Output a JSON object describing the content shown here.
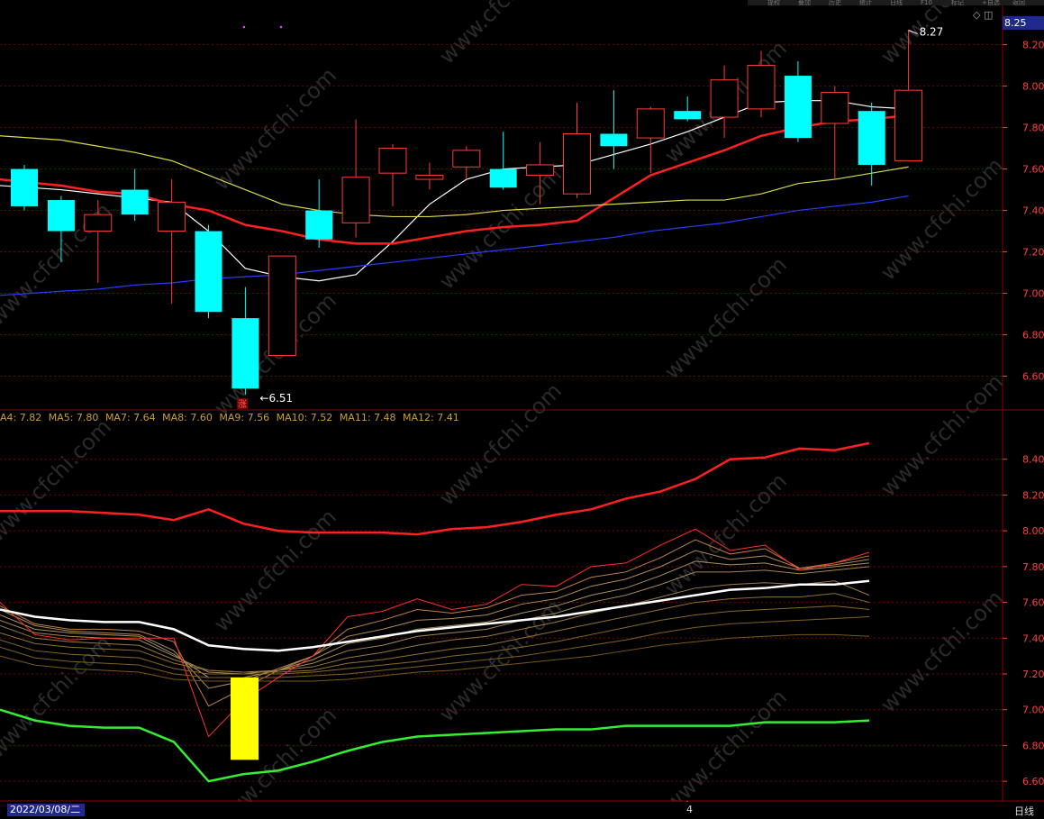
{
  "toolbar": {
    "items": [
      "提权",
      "叠加",
      "历史",
      "统计",
      "日线",
      "F10",
      "标记",
      "+自选",
      "返回"
    ]
  },
  "current_price_box": "8.25",
  "top_panel": {
    "high_label": "8.27",
    "low_label": "6.51",
    "badge": "涨"
  },
  "ma_legend": [
    "A4: 7.82",
    "MA5: 7.80",
    "MA7: 7.64",
    "MA8: 7.60",
    "MA9: 7.56",
    "MA10: 7.52",
    "MA11: 7.48",
    "MA12: 7.41"
  ],
  "bottom": {
    "date": "2022/03/08/二",
    "month_marker": "4",
    "period": "日线"
  },
  "colors": {
    "up": "#ff3b3b",
    "down": "#00ffff",
    "grid": "#7a0000",
    "axis_text": "#ff4040",
    "ma_red": "#ff2020",
    "ma_white": "#ffffff",
    "ma_yellow": "#d8d84a",
    "ma_blue": "#2a3cff",
    "band_upper": "#ff2020",
    "band_lower": "#33ee33",
    "highlight_bar": "#ffff00"
  },
  "chart_data": [
    {
      "type": "candlestick",
      "y_ticks": [
        "8.20",
        "8.00",
        "7.80",
        "7.60",
        "7.40",
        "7.20",
        "7.00",
        "6.80",
        "6.60"
      ],
      "ylim": [
        6.45,
        8.32
      ],
      "candles": [
        {
          "o": 7.6,
          "h": 7.62,
          "l": 7.4,
          "c": 7.42,
          "dir": "down"
        },
        {
          "o": 7.45,
          "h": 7.47,
          "l": 7.15,
          "c": 7.3,
          "dir": "down"
        },
        {
          "o": 7.3,
          "h": 7.45,
          "l": 7.05,
          "c": 7.38,
          "dir": "up"
        },
        {
          "o": 7.5,
          "h": 7.6,
          "l": 7.35,
          "c": 7.38,
          "dir": "down"
        },
        {
          "o": 7.3,
          "h": 7.55,
          "l": 6.95,
          "c": 7.44,
          "dir": "up"
        },
        {
          "o": 7.3,
          "h": 7.33,
          "l": 6.88,
          "c": 6.91,
          "dir": "down"
        },
        {
          "o": 6.88,
          "h": 7.03,
          "l": 6.51,
          "c": 6.54,
          "dir": "down"
        },
        {
          "o": 6.7,
          "h": 7.18,
          "l": 6.7,
          "c": 7.18,
          "dir": "up"
        },
        {
          "o": 7.4,
          "h": 7.55,
          "l": 7.22,
          "c": 7.26,
          "dir": "down"
        },
        {
          "o": 7.34,
          "h": 7.84,
          "l": 7.27,
          "c": 7.56,
          "dir": "up"
        },
        {
          "o": 7.58,
          "h": 7.72,
          "l": 7.42,
          "c": 7.7,
          "dir": "up"
        },
        {
          "o": 7.55,
          "h": 7.63,
          "l": 7.5,
          "c": 7.57,
          "dir": "up"
        },
        {
          "o": 7.61,
          "h": 7.71,
          "l": 7.55,
          "c": 7.69,
          "dir": "up"
        },
        {
          "o": 7.6,
          "h": 7.78,
          "l": 7.5,
          "c": 7.51,
          "dir": "down"
        },
        {
          "o": 7.57,
          "h": 7.73,
          "l": 7.43,
          "c": 7.62,
          "dir": "up"
        },
        {
          "o": 7.48,
          "h": 7.92,
          "l": 7.46,
          "c": 7.77,
          "dir": "up"
        },
        {
          "o": 7.77,
          "h": 7.98,
          "l": 7.6,
          "c": 7.71,
          "dir": "down"
        },
        {
          "o": 7.75,
          "h": 7.9,
          "l": 7.58,
          "c": 7.89,
          "dir": "up"
        },
        {
          "o": 7.88,
          "h": 7.95,
          "l": 7.83,
          "c": 7.84,
          "dir": "down"
        },
        {
          "o": 7.85,
          "h": 8.1,
          "l": 7.75,
          "c": 8.03,
          "dir": "up"
        },
        {
          "o": 7.89,
          "h": 8.17,
          "l": 7.85,
          "c": 8.1,
          "dir": "up"
        },
        {
          "o": 8.05,
          "h": 8.12,
          "l": 7.73,
          "c": 7.75,
          "dir": "down"
        },
        {
          "o": 7.82,
          "h": 8.0,
          "l": 7.55,
          "c": 7.97,
          "dir": "up"
        },
        {
          "o": 7.88,
          "h": 7.92,
          "l": 7.52,
          "c": 7.62,
          "dir": "down"
        },
        {
          "o": 7.64,
          "h": 8.27,
          "l": 7.64,
          "c": 7.98,
          "dir": "up"
        }
      ],
      "ma_lines": [
        {
          "name": "ma_white",
          "values": [
            7.52,
            7.5,
            7.48,
            7.46,
            7.44,
            7.3,
            7.12,
            7.08,
            7.06,
            7.09,
            7.25,
            7.43,
            7.55,
            7.6,
            7.61,
            7.62,
            7.67,
            7.72,
            7.78,
            7.85,
            7.92,
            7.93,
            7.93,
            7.9,
            7.89
          ]
        },
        {
          "name": "ma_red",
          "values": [
            7.55,
            7.52,
            7.49,
            7.48,
            7.43,
            7.4,
            7.33,
            7.3,
            7.26,
            7.24,
            7.24,
            7.27,
            7.3,
            7.32,
            7.33,
            7.35,
            7.46,
            7.57,
            7.63,
            7.69,
            7.76,
            7.8,
            7.83,
            7.84,
            7.86
          ]
        },
        {
          "name": "ma_yellow",
          "values": [
            7.76,
            7.74,
            7.71,
            7.68,
            7.64,
            7.57,
            7.5,
            7.43,
            7.4,
            7.38,
            7.37,
            7.37,
            7.38,
            7.4,
            7.41,
            7.42,
            7.43,
            7.44,
            7.45,
            7.45,
            7.48,
            7.53,
            7.55,
            7.58,
            7.61
          ]
        },
        {
          "name": "ma_blue",
          "values": [
            6.99,
            7.01,
            7.02,
            7.04,
            7.05,
            7.07,
            7.08,
            7.09,
            7.11,
            7.13,
            7.15,
            7.17,
            7.19,
            7.21,
            7.23,
            7.25,
            7.27,
            7.3,
            7.32,
            7.34,
            7.37,
            7.4,
            7.42,
            7.44,
            7.47
          ]
        }
      ]
    },
    {
      "type": "line",
      "y_ticks": [
        "8.40",
        "8.20",
        "8.00",
        "7.80",
        "7.60",
        "7.40",
        "7.20",
        "7.00",
        "6.80",
        "6.60"
      ],
      "ylim": [
        6.5,
        8.6
      ],
      "series": [
        {
          "name": "upper_band",
          "values": [
            8.11,
            8.11,
            8.11,
            8.1,
            8.09,
            8.06,
            8.12,
            8.04,
            8.0,
            7.99,
            7.99,
            7.99,
            7.98,
            8.01,
            8.02,
            8.05,
            8.09,
            8.12,
            8.18,
            8.22,
            8.29,
            8.4,
            8.41,
            8.46,
            8.45,
            8.49
          ]
        },
        {
          "name": "lower_band",
          "values": [
            7.0,
            6.94,
            6.91,
            6.9,
            6.9,
            6.82,
            6.6,
            6.64,
            6.66,
            6.71,
            6.77,
            6.82,
            6.85,
            6.86,
            6.87,
            6.88,
            6.89,
            6.89,
            6.91,
            6.91,
            6.91,
            6.91,
            6.93,
            6.93,
            6.93,
            6.94
          ]
        },
        {
          "name": "ma_bold_white",
          "values": [
            7.56,
            7.52,
            7.5,
            7.49,
            7.49,
            7.45,
            7.36,
            7.34,
            7.33,
            7.35,
            7.38,
            7.41,
            7.44,
            7.46,
            7.48,
            7.5,
            7.52,
            7.55,
            7.58,
            7.61,
            7.64,
            7.67,
            7.68,
            7.7,
            7.7,
            7.72
          ]
        },
        {
          "name": "ma_thin_red",
          "values": [
            7.6,
            7.42,
            7.39,
            7.4,
            7.4,
            7.4,
            6.85,
            7.05,
            7.18,
            7.3,
            7.52,
            7.55,
            7.62,
            7.56,
            7.59,
            7.7,
            7.69,
            7.8,
            7.82,
            7.92,
            8.01,
            7.89,
            7.92,
            7.78,
            7.82,
            7.88
          ]
        },
        {
          "name": "ma_thin_1",
          "values": [
            7.58,
            7.48,
            7.45,
            7.45,
            7.44,
            7.38,
            7.02,
            7.12,
            7.22,
            7.3,
            7.45,
            7.5,
            7.56,
            7.54,
            7.57,
            7.64,
            7.66,
            7.74,
            7.77,
            7.85,
            7.95,
            7.87,
            7.9,
            7.79,
            7.82,
            7.86
          ]
        },
        {
          "name": "ma_thin_2",
          "values": [
            7.56,
            7.47,
            7.44,
            7.43,
            7.42,
            7.33,
            7.12,
            7.16,
            7.23,
            7.3,
            7.41,
            7.45,
            7.5,
            7.51,
            7.53,
            7.59,
            7.62,
            7.69,
            7.73,
            7.8,
            7.89,
            7.84,
            7.86,
            7.79,
            7.81,
            7.84
          ]
        },
        {
          "name": "ma_thin_3",
          "values": [
            7.53,
            7.45,
            7.43,
            7.42,
            7.41,
            7.31,
            7.18,
            7.18,
            7.22,
            7.28,
            7.37,
            7.4,
            7.45,
            7.47,
            7.49,
            7.54,
            7.58,
            7.64,
            7.68,
            7.75,
            7.83,
            7.81,
            7.82,
            7.78,
            7.8,
            7.82
          ]
        },
        {
          "name": "ma_thin_4",
          "values": [
            7.5,
            7.43,
            7.41,
            7.4,
            7.39,
            7.3,
            7.21,
            7.2,
            7.22,
            7.26,
            7.33,
            7.36,
            7.41,
            7.43,
            7.45,
            7.5,
            7.54,
            7.6,
            7.64,
            7.7,
            7.77,
            7.77,
            7.78,
            7.76,
            7.78,
            7.8
          ]
        },
        {
          "name": "ma_thin_5",
          "values": [
            7.47,
            7.4,
            7.38,
            7.37,
            7.36,
            7.28,
            7.22,
            7.21,
            7.22,
            7.24,
            7.29,
            7.32,
            7.36,
            7.39,
            7.41,
            7.45,
            7.49,
            7.54,
            7.58,
            7.63,
            7.68,
            7.7,
            7.71,
            7.7,
            7.72,
            7.64
          ]
        },
        {
          "name": "ma_thin_6",
          "values": [
            7.43,
            7.37,
            7.35,
            7.34,
            7.33,
            7.26,
            7.22,
            7.21,
            7.21,
            7.22,
            7.26,
            7.28,
            7.31,
            7.34,
            7.36,
            7.4,
            7.44,
            7.48,
            7.52,
            7.56,
            7.6,
            7.62,
            7.63,
            7.63,
            7.65,
            7.6
          ]
        },
        {
          "name": "ma_thin_7",
          "values": [
            7.39,
            7.33,
            7.31,
            7.3,
            7.29,
            7.23,
            7.2,
            7.2,
            7.2,
            7.21,
            7.23,
            7.25,
            7.27,
            7.3,
            7.32,
            7.35,
            7.38,
            7.42,
            7.46,
            7.5,
            7.53,
            7.55,
            7.56,
            7.57,
            7.58,
            7.56
          ]
        },
        {
          "name": "ma_thin_8",
          "values": [
            7.35,
            7.29,
            7.27,
            7.26,
            7.25,
            7.2,
            7.18,
            7.18,
            7.18,
            7.19,
            7.2,
            7.22,
            7.24,
            7.26,
            7.28,
            7.3,
            7.33,
            7.36,
            7.39,
            7.43,
            7.46,
            7.48,
            7.49,
            7.5,
            7.51,
            7.52
          ]
        },
        {
          "name": "ma_thin_9",
          "values": [
            7.3,
            7.25,
            7.23,
            7.22,
            7.21,
            7.17,
            7.16,
            7.16,
            7.16,
            7.16,
            7.17,
            7.19,
            7.21,
            7.22,
            7.24,
            7.26,
            7.28,
            7.3,
            7.33,
            7.36,
            7.38,
            7.4,
            7.41,
            7.42,
            7.42,
            7.41
          ]
        }
      ],
      "highlight_bar": {
        "index": 7,
        "low": 6.72,
        "high": 7.18
      }
    }
  ]
}
